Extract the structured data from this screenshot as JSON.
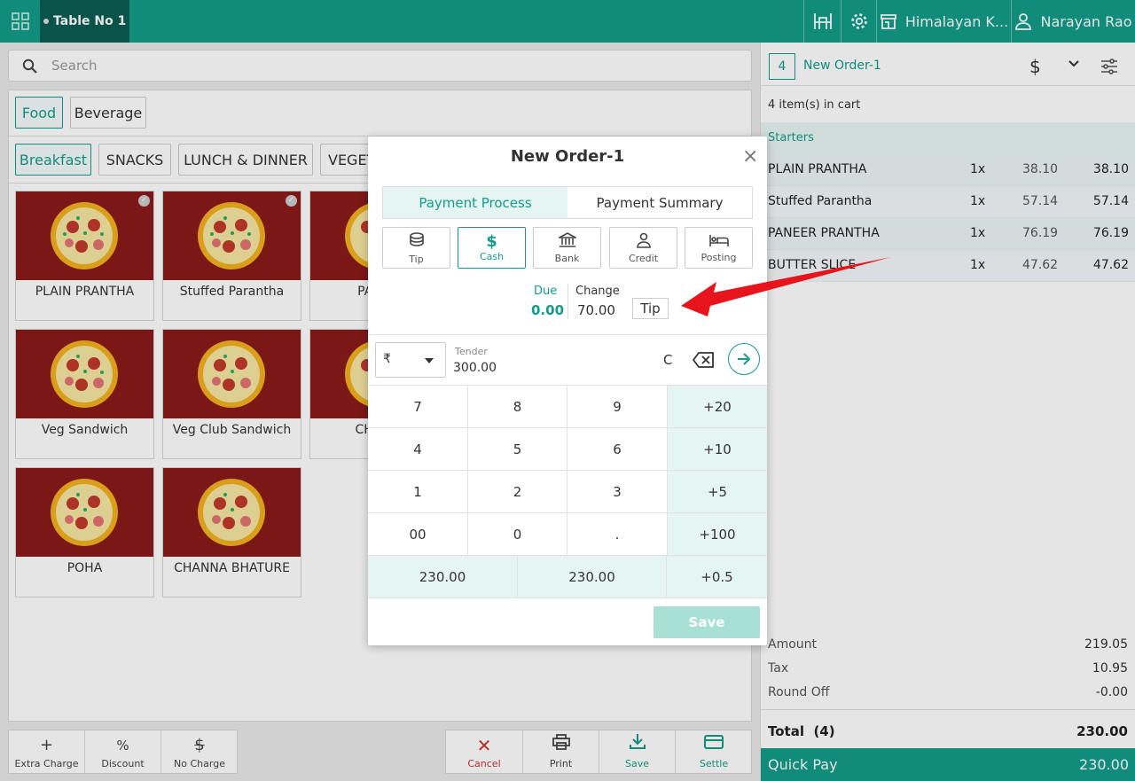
{
  "topbar": {
    "grid_icon": "apps-grid-icon",
    "table_label": "Table No 1",
    "store_name": "Himalayan K...",
    "user_name": "Narayan Rao"
  },
  "search": {
    "placeholder": "Search"
  },
  "categories": {
    "top": [
      "Food",
      "Beverage"
    ],
    "sub": [
      "Breakfast",
      "SNACKS",
      "LUNCH & DINNER",
      "VEGET"
    ]
  },
  "products": [
    {
      "name": "PLAIN PRANTHA"
    },
    {
      "name": "Stuffed Parantha"
    },
    {
      "name": "PA PRA"
    },
    {
      "name": "Veg Sandwich"
    },
    {
      "name": "Veg Club Sandwich"
    },
    {
      "name": "CH SAN"
    },
    {
      "name": "POHA"
    },
    {
      "name": "CHANNA BHATURE"
    }
  ],
  "bottom_actions": {
    "extra_charge": "Extra Charge",
    "discount": "Discount",
    "no_charge": "No Charge",
    "cancel": "Cancel",
    "print": "Print",
    "save": "Save",
    "settle": "Settle"
  },
  "cart": {
    "count_badge": "4",
    "order_name": "New Order-1",
    "items_in_cart": "4 item(s) in cart",
    "section": "Starters",
    "items": [
      {
        "name": "PLAIN PRANTHA",
        "qty": "1x",
        "price": "38.10",
        "total": "38.10"
      },
      {
        "name": "Stuffed Parantha",
        "qty": "1x",
        "price": "57.14",
        "total": "57.14"
      },
      {
        "name": "PANEER PRANTHA",
        "qty": "1x",
        "price": "76.19",
        "total": "76.19"
      },
      {
        "name": "BUTTER SLICE",
        "qty": "1x",
        "price": "47.62",
        "total": "47.62"
      }
    ],
    "summary": {
      "amount_label": "Amount",
      "amount": "219.05",
      "tax_label": "Tax",
      "tax": "10.95",
      "roundoff_label": "Round Off",
      "roundoff": "-0.00",
      "total_label": "Total",
      "total_count": "(4)",
      "total": "230.00"
    },
    "quick_pay_label": "Quick Pay",
    "quick_pay_amount": "230.00"
  },
  "modal": {
    "title": "New Order-1",
    "tabs": [
      "Payment Process",
      "Payment Summary"
    ],
    "methods": [
      {
        "label": "Tip",
        "icon": "coins-icon"
      },
      {
        "label": "Cash",
        "icon": "dollar-icon"
      },
      {
        "label": "Bank",
        "icon": "bank-icon"
      },
      {
        "label": "Credit",
        "icon": "user-icon"
      },
      {
        "label": "Posting",
        "icon": "bed-icon"
      }
    ],
    "due_label": "Due",
    "due_value": "0.00",
    "change_label": "Change",
    "change_value": "70.00",
    "tip_button": "Tip",
    "currency": "₹",
    "tender_label": "Tender",
    "tender_value": "300.00",
    "clear_label": "C",
    "keypad": [
      [
        "7",
        "8",
        "9",
        "+20"
      ],
      [
        "4",
        "5",
        "6",
        "+10"
      ],
      [
        "1",
        "2",
        "3",
        "+5"
      ],
      [
        "00",
        "0",
        ".",
        "+100"
      ]
    ],
    "quick_amounts": [
      "230.00",
      "230.00",
      "+0.5"
    ],
    "save_label": "Save"
  },
  "colors": {
    "accent": "#149c8a",
    "dark_accent": "#0b5d53",
    "arrow": "#e8141b",
    "light_green": "#e4f5f2"
  }
}
